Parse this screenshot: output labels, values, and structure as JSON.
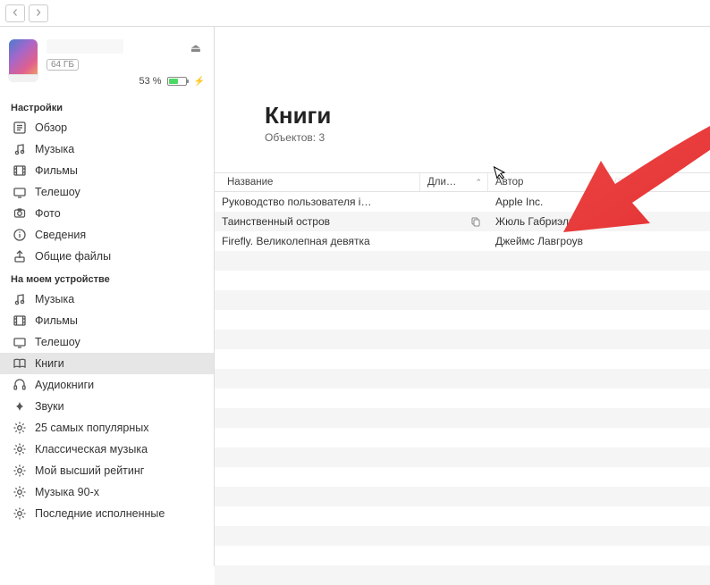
{
  "toolbar": {
    "back": "‹",
    "forward": "›"
  },
  "device": {
    "storage_badge": "64 ГБ",
    "battery_pct": "53 %",
    "battery_fill_pct": 53
  },
  "sidebar": {
    "settings_title": "Настройки",
    "settings_items": [
      {
        "icon": "summary",
        "label": "Обзор"
      },
      {
        "icon": "music",
        "label": "Музыка"
      },
      {
        "icon": "movies",
        "label": "Фильмы"
      },
      {
        "icon": "tv",
        "label": "Телешоу"
      },
      {
        "icon": "photos",
        "label": "Фото"
      },
      {
        "icon": "info",
        "label": "Сведения"
      },
      {
        "icon": "files",
        "label": "Общие файлы"
      }
    ],
    "ondevice_title": "На моем устройстве",
    "ondevice_items": [
      {
        "icon": "music",
        "label": "Музыка"
      },
      {
        "icon": "movies",
        "label": "Фильмы"
      },
      {
        "icon": "tv",
        "label": "Телешоу"
      },
      {
        "icon": "books",
        "label": "Книги",
        "selected": true
      },
      {
        "icon": "audiobk",
        "label": "Аудиокниги"
      },
      {
        "icon": "tones",
        "label": "Звуки"
      },
      {
        "icon": "gear",
        "label": "25 самых популярных"
      },
      {
        "icon": "gear",
        "label": "Классическая музыка"
      },
      {
        "icon": "gear",
        "label": "Мой высший рейтинг"
      },
      {
        "icon": "gear",
        "label": "Музыка 90-х"
      },
      {
        "icon": "gear",
        "label": "Последние исполненные"
      }
    ]
  },
  "content": {
    "title": "Книги",
    "subtitle": "Объектов: 3",
    "columns": {
      "name": "Название",
      "duration": "Дли…",
      "author": "Автор"
    },
    "rows": [
      {
        "name": "Руководство пользователя i…",
        "author": "Apple Inc."
      },
      {
        "name": "Таинственный остров",
        "author": "Жюль Габриэль Ве…",
        "has_copy_icon": true
      },
      {
        "name": "Firefly. Великолепная девятка",
        "author": "Джеймс Лавгроув"
      }
    ]
  },
  "colors": {
    "arrow": "#ee3b3b"
  }
}
